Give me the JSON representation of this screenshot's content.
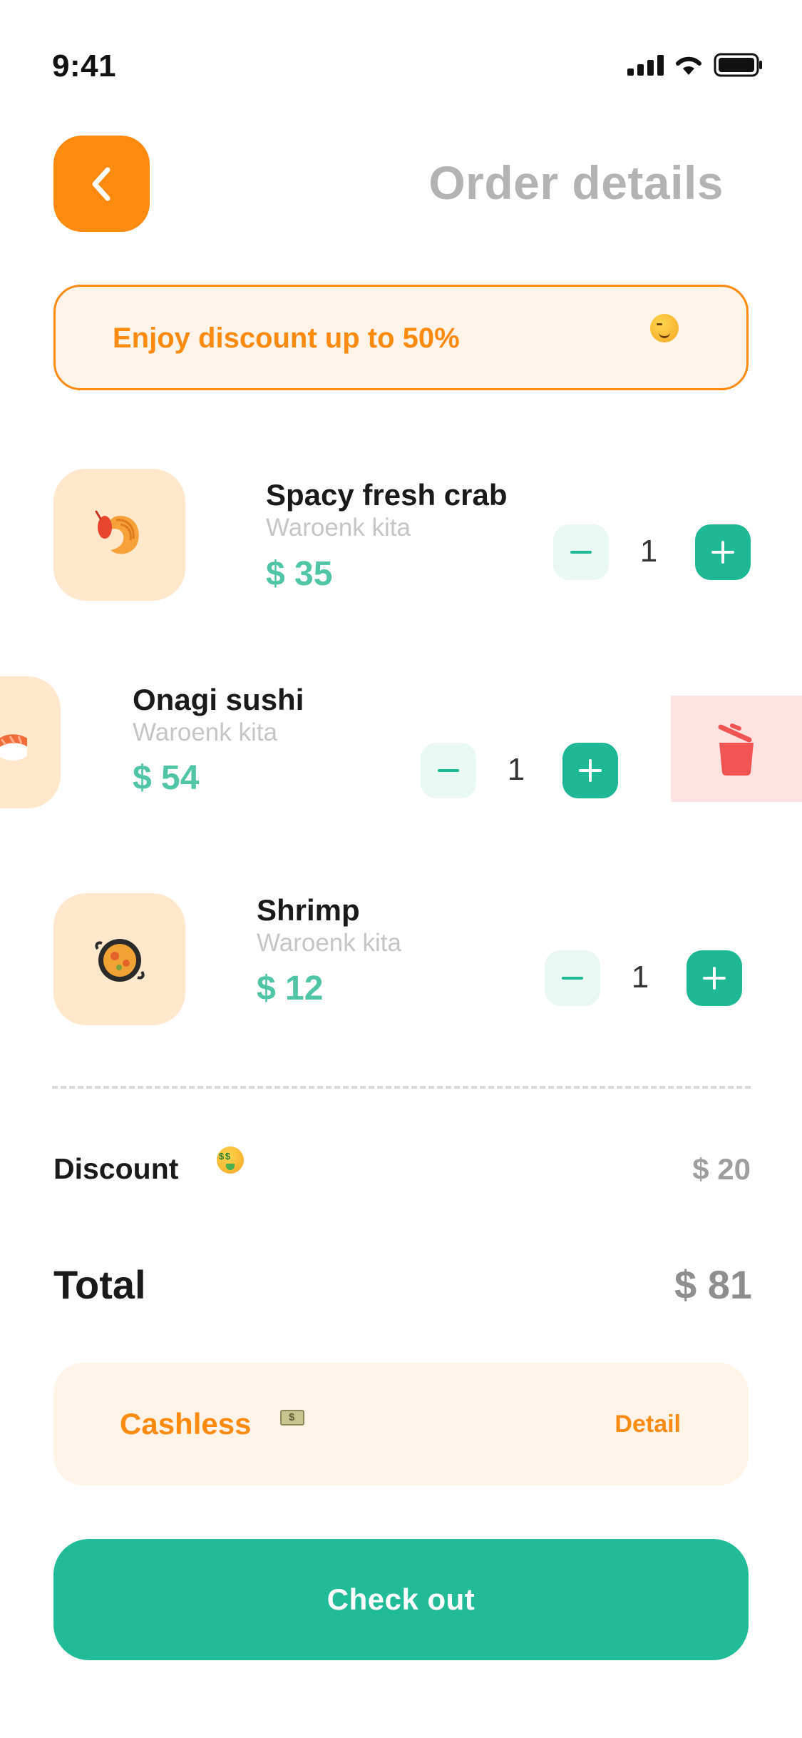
{
  "status_bar": {
    "time": "9:41"
  },
  "header": {
    "title": "Order details"
  },
  "promo": {
    "text": "Enjoy discount up to 50%",
    "emoji": "wink-emoji-icon"
  },
  "items": [
    {
      "name": "Spacy fresh crab",
      "shop": "Waroenk kita",
      "price": "$ 35",
      "quantity": "1",
      "image": "shrimp-icon"
    },
    {
      "name": "Onagi sushi",
      "shop": "Waroenk kita",
      "price": "$ 54",
      "quantity": "1",
      "image": "sushi-icon"
    },
    {
      "name": "Shrimp",
      "shop": "Waroenk kita",
      "price": "$ 12",
      "quantity": "1",
      "image": "paella-pan-icon"
    }
  ],
  "summary": {
    "discount_label": "Discount",
    "discount_value": "$ 20",
    "total_label": "Total",
    "total_value": "$ 81"
  },
  "payment": {
    "method": "Cashless",
    "detail_label": "Detail"
  },
  "checkout_label": "Check out",
  "colors": {
    "accent_orange": "#FF8A10",
    "accent_green": "#22BB98",
    "price_green": "#4FC5A6",
    "delete_red": "#F25454"
  }
}
